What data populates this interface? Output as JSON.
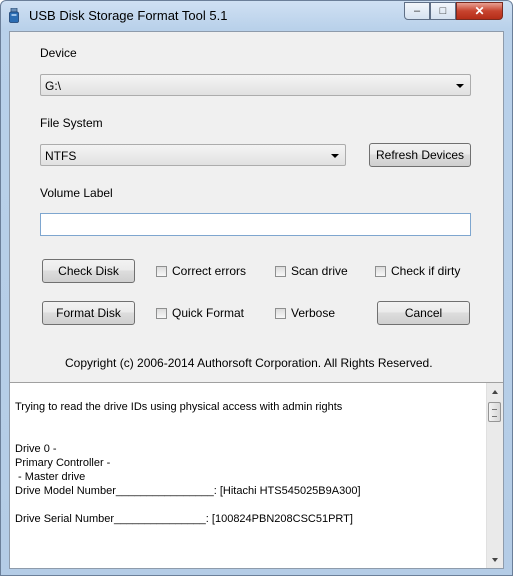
{
  "window": {
    "title": "USB Disk Storage Format Tool 5.1",
    "controls": {
      "minimize": "‒",
      "maximize": "□",
      "close": "✕"
    }
  },
  "form": {
    "device_label": "Device",
    "device_value": "G:\\",
    "filesystem_label": "File System",
    "filesystem_value": "NTFS",
    "refresh_button": "Refresh Devices",
    "volume_label": "Volume Label",
    "volume_value": "",
    "check_disk_button": "Check Disk",
    "format_disk_button": "Format Disk",
    "cancel_button": "Cancel",
    "options": {
      "correct_errors": "Correct errors",
      "scan_drive": "Scan drive",
      "check_if_dirty": "Check if dirty",
      "quick_format": "Quick Format",
      "verbose": "Verbose"
    },
    "copyright": "Copyright (c) 2006-2014 Authorsoft Corporation. All Rights Reserved."
  },
  "log": {
    "lines": [
      "Trying to read the drive IDs using physical access with admin rights",
      "Drive 0 -",
      "Primary Controller -",
      " - Master drive",
      "Drive Model Number________________: [Hitachi HTS545025B9A300]",
      "Drive Serial Number_______________: [100824PBN208CSC51PRT]"
    ]
  },
  "colors": {
    "title_bar": "#b9d1ea",
    "client_bg": "#f0f0f0",
    "close_red": "#c7432e"
  }
}
